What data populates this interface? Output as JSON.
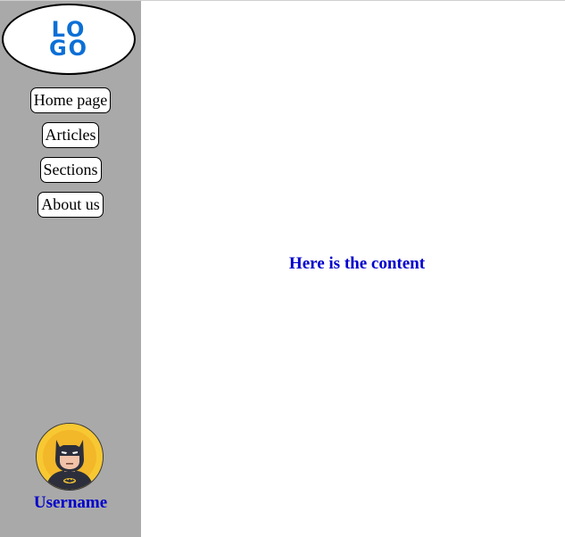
{
  "sidebar": {
    "logo": {
      "line1": "LO",
      "line2": "GO"
    },
    "nav": [
      {
        "label": "Home page"
      },
      {
        "label": "Articles"
      },
      {
        "label": "Sections"
      },
      {
        "label": "About us"
      }
    ],
    "user": {
      "avatar_icon": "batman-avatar-icon",
      "username": "Username"
    }
  },
  "main": {
    "content_text": "Here is the content"
  },
  "colors": {
    "sidebar_bg": "#a9a9a9",
    "logo_blue": "#0c6fd6",
    "text_blue": "#0000cc",
    "avatar_bg": "#f7c832"
  }
}
